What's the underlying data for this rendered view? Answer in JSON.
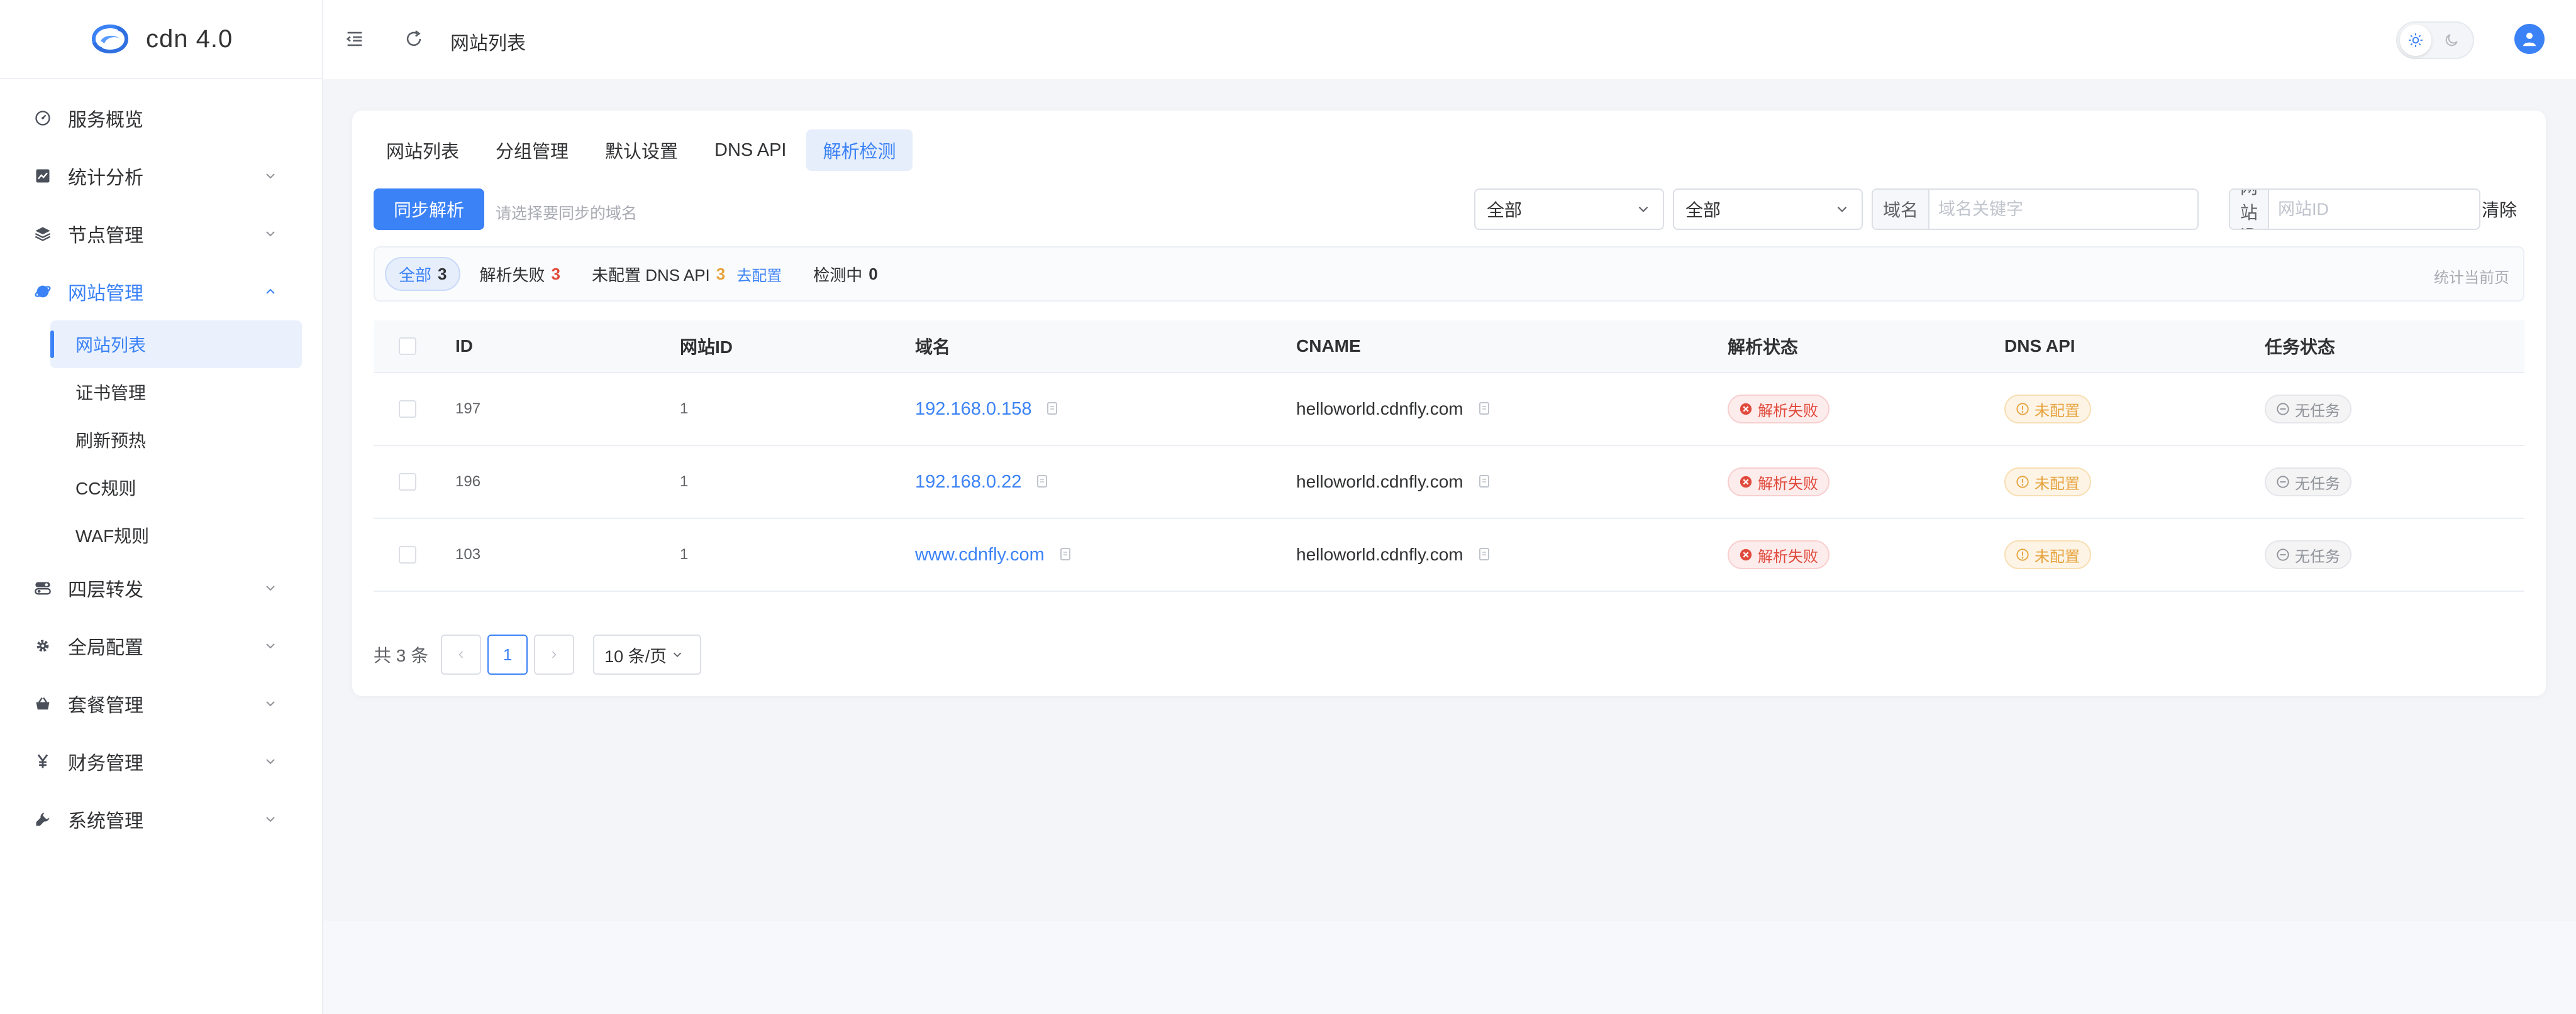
{
  "app": {
    "name": "cdn 4.0"
  },
  "header": {
    "title": "网站列表"
  },
  "sidebar": {
    "items": [
      {
        "label": "服务概览"
      },
      {
        "label": "统计分析"
      },
      {
        "label": "节点管理"
      },
      {
        "label": "网站管理"
      },
      {
        "label": "四层转发"
      },
      {
        "label": "全局配置"
      },
      {
        "label": "套餐管理"
      },
      {
        "label": "财务管理"
      },
      {
        "label": "系统管理"
      }
    ],
    "submenu": [
      {
        "label": "网站列表"
      },
      {
        "label": "证书管理"
      },
      {
        "label": "刷新预热"
      },
      {
        "label": "CC规则"
      },
      {
        "label": "WAF规则"
      }
    ]
  },
  "tabs": [
    {
      "label": "网站列表"
    },
    {
      "label": "分组管理"
    },
    {
      "label": "默认设置"
    },
    {
      "label": "DNS API"
    },
    {
      "label": "解析检测"
    }
  ],
  "toolbar": {
    "sync_label": "同步解析",
    "sync_hint": "请选择要同步的域名",
    "select1": "全部",
    "select2": "全部",
    "domain_prefix": "域名",
    "domain_placeholder": "域名关键字",
    "siteid_prefix": "网站ID",
    "siteid_placeholder": "网站ID",
    "clear_label": "清除"
  },
  "filters": {
    "all_label": "全部",
    "all_count": "3",
    "fail_label": "解析失败",
    "fail_count": "3",
    "nodns_label": "未配置 DNS API",
    "nodns_count": "3",
    "nodns_link": "去配置",
    "checking_label": "检测中",
    "checking_count": "0",
    "note": "统计当前页"
  },
  "table": {
    "headers": {
      "id": "ID",
      "site_id": "网站ID",
      "domain": "域名",
      "cname": "CNAME",
      "status": "解析状态",
      "dns_api": "DNS API",
      "task": "任务状态"
    },
    "rows": [
      {
        "id": "197",
        "site_id": "1",
        "domain": "192.168.0.158",
        "cname": "helloworld.cdnfly.com",
        "status": "解析失败",
        "dns_api": "未配置",
        "task": "无任务"
      },
      {
        "id": "196",
        "site_id": "1",
        "domain": "192.168.0.22",
        "cname": "helloworld.cdnfly.com",
        "status": "解析失败",
        "dns_api": "未配置",
        "task": "无任务"
      },
      {
        "id": "103",
        "site_id": "1",
        "domain": "www.cdnfly.com",
        "cname": "helloworld.cdnfly.com",
        "status": "解析失败",
        "dns_api": "未配置",
        "task": "无任务"
      }
    ]
  },
  "pagination": {
    "total": "共 3 条",
    "page": "1",
    "page_size": "10 条/页"
  },
  "colors": {
    "primary": "#3b82f6",
    "danger": "#e04a3c",
    "warning": "#e6a23c",
    "info": "#909399"
  }
}
